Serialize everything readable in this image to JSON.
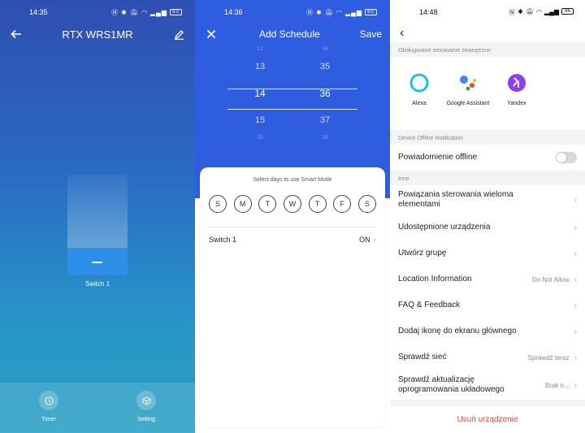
{
  "panel1": {
    "status": {
      "time": "14:35",
      "battery": "80"
    },
    "title": "RTX WRS1MR",
    "switch_label": "Switch 1",
    "bottom": {
      "timer_label": "Timer",
      "setting_label": "Setting"
    }
  },
  "panel2": {
    "status": {
      "time": "14:36",
      "battery": "80"
    },
    "title": "Add Schedule",
    "save_label": "Save",
    "picker": {
      "hours": [
        "12",
        "13",
        "14",
        "15",
        "16"
      ],
      "minutes": [
        "34",
        "35",
        "36",
        "37",
        "38"
      ],
      "selected_hour": "14",
      "selected_minute": "36"
    },
    "days_hint": "Select days to use Smart Mode",
    "days": [
      "S",
      "M",
      "T",
      "W",
      "T",
      "F",
      "S"
    ],
    "switch_row": {
      "label": "Switch 1",
      "value": "ON"
    }
  },
  "panel3": {
    "status": {
      "time": "14:48",
      "battery": "86"
    },
    "section_external": "Obsługiwane sterowanie zewnętrzne",
    "assistants": [
      {
        "label": "Alexa",
        "icon": "alexa-icon"
      },
      {
        "label": "Google Assistant",
        "icon": "google-assistant-icon"
      },
      {
        "label": "Yandex",
        "icon": "yandex-icon"
      }
    ],
    "section_offline": "Device Offline Notification",
    "offline_label": "Powiadomienie offline",
    "section_other": "Inne",
    "rows": [
      {
        "label": "Powiązania sterowania wieloma elementami",
        "value": ""
      },
      {
        "label": "Udostępnione urządzenia",
        "value": ""
      },
      {
        "label": "Utwórz grupę",
        "value": ""
      },
      {
        "label": "Location Information",
        "value": "Do Not Allow"
      },
      {
        "label": "FAQ & Feedback",
        "value": ""
      },
      {
        "label": "Dodaj ikonę do ekranu głównego",
        "value": ""
      },
      {
        "label": "Sprawdź sieć",
        "value": "Sprawdź teraz"
      },
      {
        "label": "Sprawdź aktualizację oprogramowania układowego",
        "value": "Brak n..."
      }
    ],
    "remove_label": "Usuń urządzenie"
  },
  "colors": {
    "accent_blue": "#2f5de0",
    "remove_red": "#e5453a",
    "switch_blue": "#2e8fe8"
  }
}
